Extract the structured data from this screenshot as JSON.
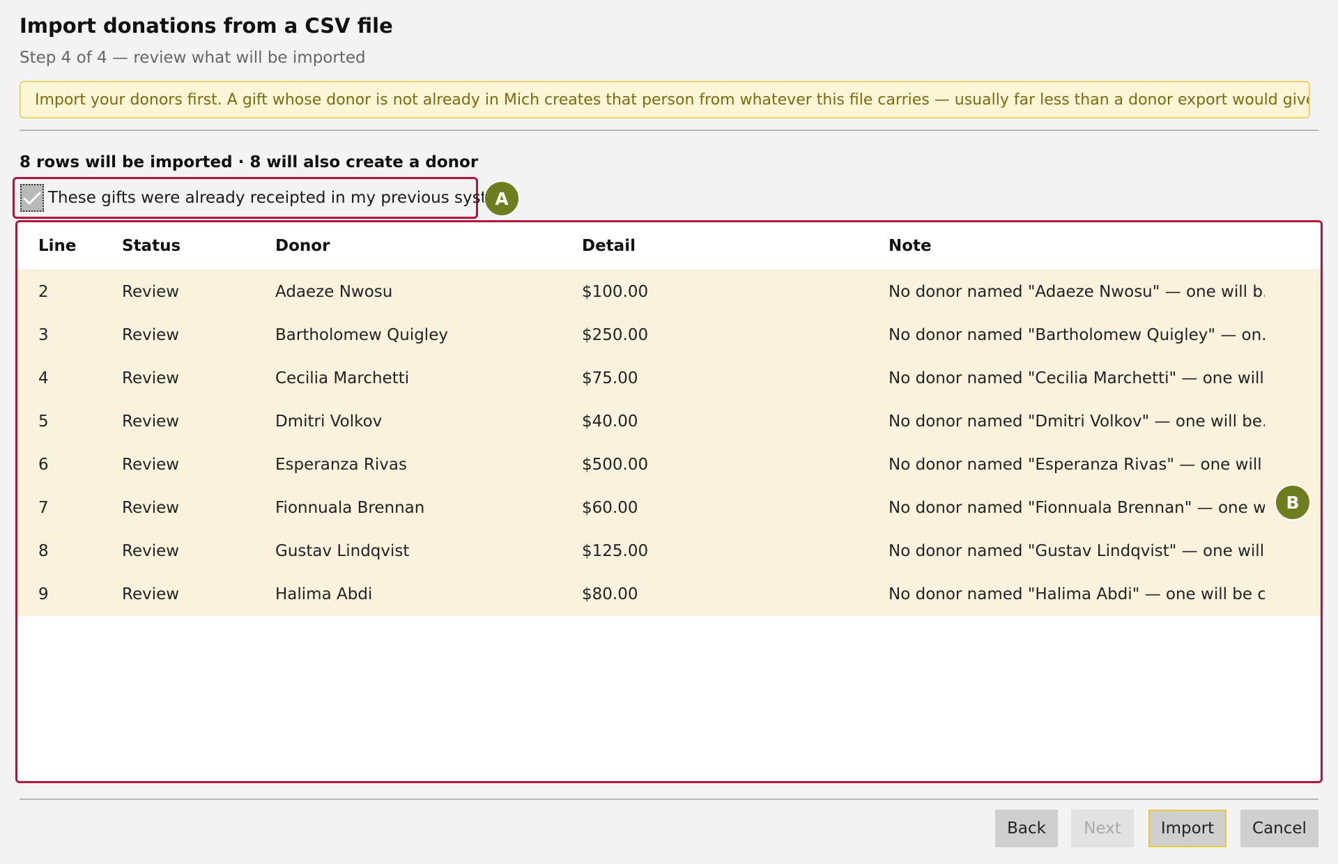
{
  "header": {
    "title": "Import donations from a CSV file",
    "subtitle": "Step 4 of 4 — review what will be imported"
  },
  "warning": "Import your donors first. A gift whose donor is not already in Mich creates that person from whatever this file carries — usually far less than a donor export would give you.",
  "summary": "8 rows will be imported · 8 will also create a donor",
  "receipted_checkbox": {
    "label": "These gifts were already receipted in my previous system",
    "checked": true
  },
  "markers": {
    "a": "A",
    "b": "B"
  },
  "table": {
    "columns": [
      "Line",
      "Status",
      "Donor",
      "Detail",
      "Note"
    ],
    "rows": [
      {
        "line": "2",
        "status": "Review",
        "donor": "Adaeze Nwosu",
        "detail": "$100.00",
        "note": "No donor named \"Adaeze Nwosu\" — one will b..."
      },
      {
        "line": "3",
        "status": "Review",
        "donor": "Bartholomew Quigley",
        "detail": "$250.00",
        "note": "No donor named \"Bartholomew Quigley\" — on..."
      },
      {
        "line": "4",
        "status": "Review",
        "donor": "Cecilia Marchetti",
        "detail": "$75.00",
        "note": "No donor named \"Cecilia Marchetti\" — one will..."
      },
      {
        "line": "5",
        "status": "Review",
        "donor": "Dmitri Volkov",
        "detail": "$40.00",
        "note": "No donor named \"Dmitri Volkov\" — one will be..."
      },
      {
        "line": "6",
        "status": "Review",
        "donor": "Esperanza Rivas",
        "detail": "$500.00",
        "note": "No donor named \"Esperanza Rivas\" — one will ..."
      },
      {
        "line": "7",
        "status": "Review",
        "donor": "Fionnuala Brennan",
        "detail": "$60.00",
        "note": "No donor named \"Fionnuala Brennan\" — one w..."
      },
      {
        "line": "8",
        "status": "Review",
        "donor": "Gustav Lindqvist",
        "detail": "$125.00",
        "note": "No donor named \"Gustav Lindqvist\" — one will ..."
      },
      {
        "line": "9",
        "status": "Review",
        "donor": "Halima Abdi",
        "detail": "$80.00",
        "note": "No donor named \"Halima Abdi\" — one will be c..."
      }
    ]
  },
  "buttons": {
    "back": "Back",
    "next": "Next",
    "import": "Import",
    "cancel": "Cancel"
  },
  "colors": {
    "highlight_border": "#b0163b",
    "marker": "#6e7e1f",
    "row_background": "#fbf2de",
    "warning_background": "#fdf6d6"
  }
}
